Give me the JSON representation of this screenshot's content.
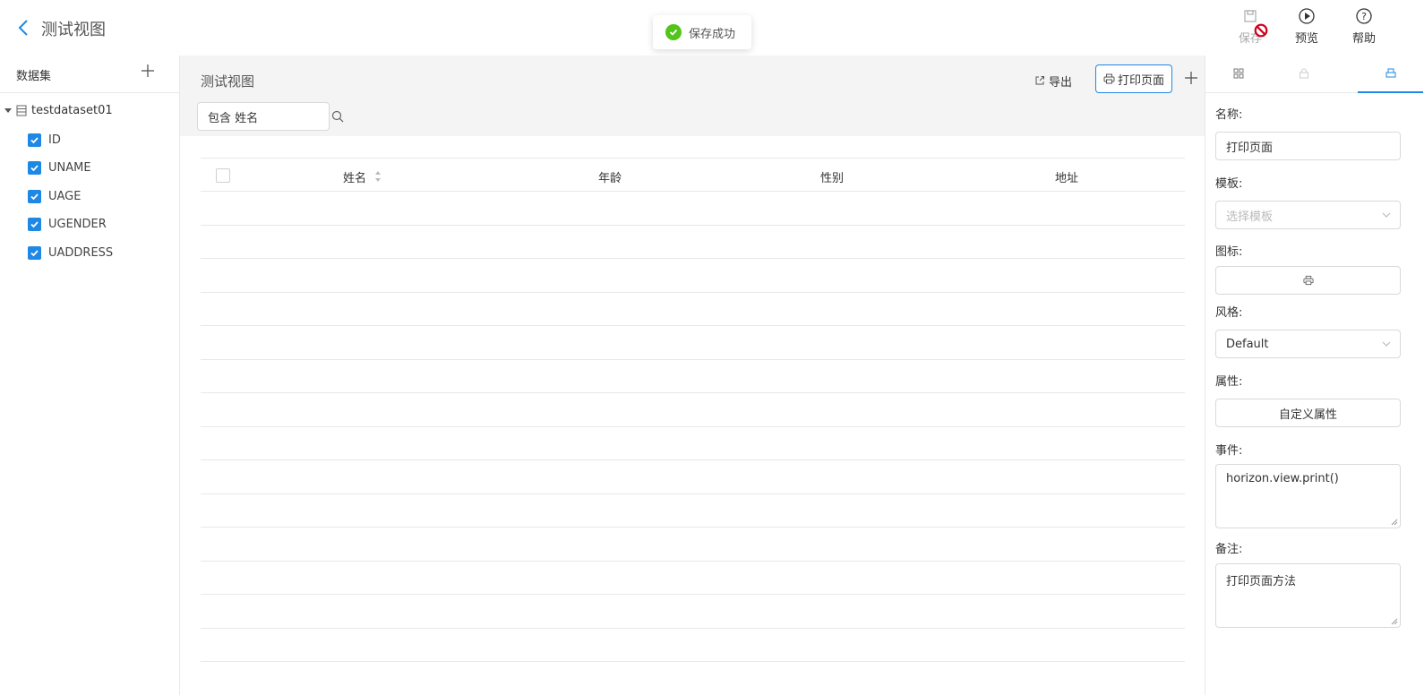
{
  "header": {
    "title": "测试视图",
    "toast": "保存成功",
    "buttons": {
      "save": "保存",
      "preview": "预览",
      "help": "帮助"
    },
    "icons": [
      "back-arrow-icon",
      "save-icon",
      "forbidden-icon",
      "play-circle-icon",
      "help-circle-icon"
    ]
  },
  "sidebar": {
    "title": "数据集",
    "dataset": "testdataset01",
    "fields": [
      {
        "label": "ID",
        "checked": true
      },
      {
        "label": "UNAME",
        "checked": true
      },
      {
        "label": "UAGE",
        "checked": true
      },
      {
        "label": "UGENDER",
        "checked": true
      },
      {
        "label": "UADDRESS",
        "checked": true
      }
    ]
  },
  "main": {
    "title": "测试视图",
    "export_label": "导出",
    "print_label": "打印页面",
    "search_value": "包含 姓名",
    "table": {
      "columns": [
        "姓名",
        "年龄",
        "性别",
        "地址"
      ],
      "rows": []
    }
  },
  "panel": {
    "tabs": [
      "grid-icon",
      "lock-icon",
      "print-icon"
    ],
    "active_tab": 2,
    "name_label": "名称:",
    "name_value": "打印页面",
    "template_label": "模板:",
    "template_placeholder": "选择模板",
    "icon_label": "图标:",
    "style_label": "风格:",
    "style_value": "Default",
    "attr_label": "属性:",
    "attr_button": "自定义属性",
    "event_label": "事件:",
    "event_value": "horizon.view.print()",
    "note_label": "备注:",
    "note_value": "打印页面方法"
  },
  "colors": {
    "accent": "#1e88e5",
    "success": "#52c41a",
    "forbidden": "#d0021b"
  }
}
